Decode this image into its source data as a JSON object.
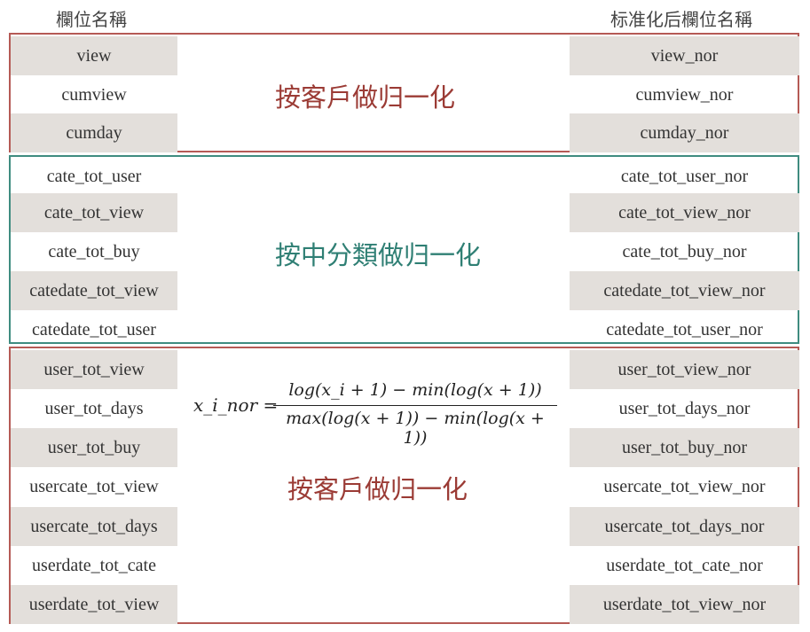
{
  "headers": {
    "left": "欄位名稱",
    "right": "标准化后欄位名稱"
  },
  "groups": [
    {
      "label": "按客戶做归一化",
      "rows": [
        {
          "name": "view",
          "normalized": "view_nor"
        },
        {
          "name": "cumview",
          "normalized": "cumview_nor"
        },
        {
          "name": "cumday",
          "normalized": "cumday_nor"
        }
      ]
    },
    {
      "label": "按中分類做归一化",
      "rows": [
        {
          "name": "cate_tot_user",
          "normalized": "cate_tot_user_nor"
        },
        {
          "name": "cate_tot_view",
          "normalized": "cate_tot_view_nor"
        },
        {
          "name": "cate_tot_buy",
          "normalized": "cate_tot_buy_nor"
        },
        {
          "name": "catedate_tot_view",
          "normalized": "catedate_tot_view_nor"
        },
        {
          "name": "catedate_tot_user",
          "normalized": "catedate_tot_user_nor"
        }
      ]
    },
    {
      "label": "按客戶做归一化",
      "rows": [
        {
          "name": "user_tot_view",
          "normalized": "user_tot_view_nor"
        },
        {
          "name": "user_tot_days",
          "normalized": "user_tot_days_nor"
        },
        {
          "name": "user_tot_buy",
          "normalized": "user_tot_buy_nor"
        },
        {
          "name": "usercate_tot_view",
          "normalized": "usercate_tot_view_nor"
        },
        {
          "name": "usercate_tot_days",
          "normalized": "usercate_tot_days_nor"
        },
        {
          "name": "userdate_tot_cate",
          "normalized": "userdate_tot_cate_nor"
        },
        {
          "name": "userdate_tot_view",
          "normalized": "userdate_tot_view_nor"
        }
      ]
    }
  ],
  "formula": {
    "lhs": "x_i_nor =",
    "numerator": "log(x_i + 1) − min(log(x + 1))",
    "denominator": "max(log(x + 1)) − min(log(x + 1))"
  },
  "colors": {
    "red_border": "#b55a55",
    "teal_border": "#3f8c80",
    "shade": "#e3dfdb"
  }
}
